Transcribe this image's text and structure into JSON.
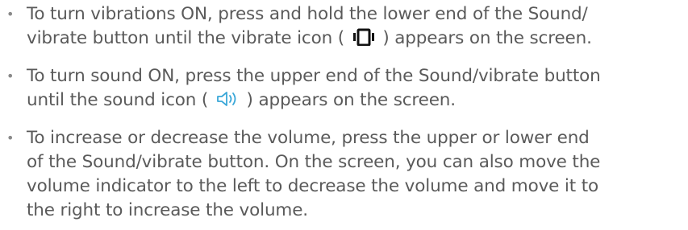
{
  "items": [
    {
      "bullet": "•",
      "before": "To turn vibrations ON, press and hold the lower end of the Sound/",
      "line2_before": "vibrate button until the vibrate icon ( ",
      "icon": "vibrate-icon",
      "after": " ) appears on the screen."
    },
    {
      "bullet": "•",
      "before": "To turn sound ON, press the upper end of the Sound/vibrate button",
      "line2_before": "until the sound icon ( ",
      "icon": "sound-icon",
      "icon_color": "#3aa7d8",
      "after": " ) appears on the screen."
    },
    {
      "bullet": "•",
      "line1": "To increase or decrease the volume, press the upper or lower end",
      "line2": "of the Sound/vibrate button. On the screen, you can also move the",
      "line3": "volume indicator to the left to decrease the volume and move it to",
      "line4": "the right to increase the volume."
    }
  ]
}
